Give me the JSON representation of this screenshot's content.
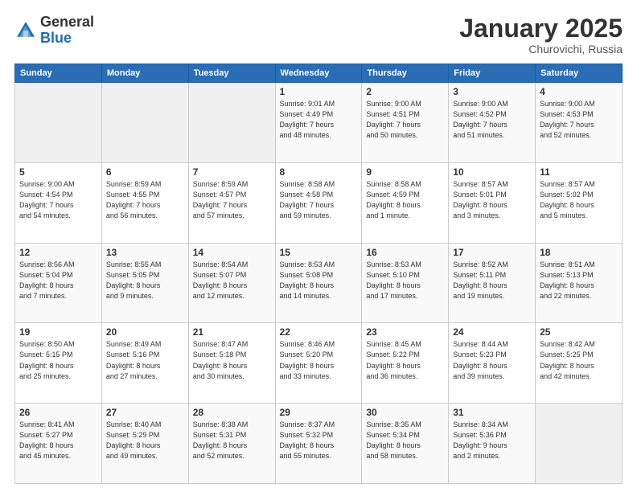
{
  "header": {
    "logo_general": "General",
    "logo_blue": "Blue",
    "month": "January 2025",
    "location": "Churovichi, Russia"
  },
  "weekdays": [
    "Sunday",
    "Monday",
    "Tuesday",
    "Wednesday",
    "Thursday",
    "Friday",
    "Saturday"
  ],
  "weeks": [
    [
      {
        "day": "",
        "info": ""
      },
      {
        "day": "",
        "info": ""
      },
      {
        "day": "",
        "info": ""
      },
      {
        "day": "1",
        "info": "Sunrise: 9:01 AM\nSunset: 4:49 PM\nDaylight: 7 hours\nand 48 minutes."
      },
      {
        "day": "2",
        "info": "Sunrise: 9:00 AM\nSunset: 4:51 PM\nDaylight: 7 hours\nand 50 minutes."
      },
      {
        "day": "3",
        "info": "Sunrise: 9:00 AM\nSunset: 4:52 PM\nDaylight: 7 hours\nand 51 minutes."
      },
      {
        "day": "4",
        "info": "Sunrise: 9:00 AM\nSunset: 4:53 PM\nDaylight: 7 hours\nand 52 minutes."
      }
    ],
    [
      {
        "day": "5",
        "info": "Sunrise: 9:00 AM\nSunset: 4:54 PM\nDaylight: 7 hours\nand 54 minutes."
      },
      {
        "day": "6",
        "info": "Sunrise: 8:59 AM\nSunset: 4:55 PM\nDaylight: 7 hours\nand 56 minutes."
      },
      {
        "day": "7",
        "info": "Sunrise: 8:59 AM\nSunset: 4:57 PM\nDaylight: 7 hours\nand 57 minutes."
      },
      {
        "day": "8",
        "info": "Sunrise: 8:58 AM\nSunset: 4:58 PM\nDaylight: 7 hours\nand 59 minutes."
      },
      {
        "day": "9",
        "info": "Sunrise: 8:58 AM\nSunset: 4:59 PM\nDaylight: 8 hours\nand 1 minute."
      },
      {
        "day": "10",
        "info": "Sunrise: 8:57 AM\nSunset: 5:01 PM\nDaylight: 8 hours\nand 3 minutes."
      },
      {
        "day": "11",
        "info": "Sunrise: 8:57 AM\nSunset: 5:02 PM\nDaylight: 8 hours\nand 5 minutes."
      }
    ],
    [
      {
        "day": "12",
        "info": "Sunrise: 8:56 AM\nSunset: 5:04 PM\nDaylight: 8 hours\nand 7 minutes."
      },
      {
        "day": "13",
        "info": "Sunrise: 8:55 AM\nSunset: 5:05 PM\nDaylight: 8 hours\nand 9 minutes."
      },
      {
        "day": "14",
        "info": "Sunrise: 8:54 AM\nSunset: 5:07 PM\nDaylight: 8 hours\nand 12 minutes."
      },
      {
        "day": "15",
        "info": "Sunrise: 8:53 AM\nSunset: 5:08 PM\nDaylight: 8 hours\nand 14 minutes."
      },
      {
        "day": "16",
        "info": "Sunrise: 8:53 AM\nSunset: 5:10 PM\nDaylight: 8 hours\nand 17 minutes."
      },
      {
        "day": "17",
        "info": "Sunrise: 8:52 AM\nSunset: 5:11 PM\nDaylight: 8 hours\nand 19 minutes."
      },
      {
        "day": "18",
        "info": "Sunrise: 8:51 AM\nSunset: 5:13 PM\nDaylight: 8 hours\nand 22 minutes."
      }
    ],
    [
      {
        "day": "19",
        "info": "Sunrise: 8:50 AM\nSunset: 5:15 PM\nDaylight: 8 hours\nand 25 minutes."
      },
      {
        "day": "20",
        "info": "Sunrise: 8:49 AM\nSunset: 5:16 PM\nDaylight: 8 hours\nand 27 minutes."
      },
      {
        "day": "21",
        "info": "Sunrise: 8:47 AM\nSunset: 5:18 PM\nDaylight: 8 hours\nand 30 minutes."
      },
      {
        "day": "22",
        "info": "Sunrise: 8:46 AM\nSunset: 5:20 PM\nDaylight: 8 hours\nand 33 minutes."
      },
      {
        "day": "23",
        "info": "Sunrise: 8:45 AM\nSunset: 5:22 PM\nDaylight: 8 hours\nand 36 minutes."
      },
      {
        "day": "24",
        "info": "Sunrise: 8:44 AM\nSunset: 5:23 PM\nDaylight: 8 hours\nand 39 minutes."
      },
      {
        "day": "25",
        "info": "Sunrise: 8:42 AM\nSunset: 5:25 PM\nDaylight: 8 hours\nand 42 minutes."
      }
    ],
    [
      {
        "day": "26",
        "info": "Sunrise: 8:41 AM\nSunset: 5:27 PM\nDaylight: 8 hours\nand 45 minutes."
      },
      {
        "day": "27",
        "info": "Sunrise: 8:40 AM\nSunset: 5:29 PM\nDaylight: 8 hours\nand 49 minutes."
      },
      {
        "day": "28",
        "info": "Sunrise: 8:38 AM\nSunset: 5:31 PM\nDaylight: 8 hours\nand 52 minutes."
      },
      {
        "day": "29",
        "info": "Sunrise: 8:37 AM\nSunset: 5:32 PM\nDaylight: 8 hours\nand 55 minutes."
      },
      {
        "day": "30",
        "info": "Sunrise: 8:35 AM\nSunset: 5:34 PM\nDaylight: 8 hours\nand 58 minutes."
      },
      {
        "day": "31",
        "info": "Sunrise: 8:34 AM\nSunset: 5:36 PM\nDaylight: 9 hours\nand 2 minutes."
      },
      {
        "day": "",
        "info": ""
      }
    ]
  ]
}
